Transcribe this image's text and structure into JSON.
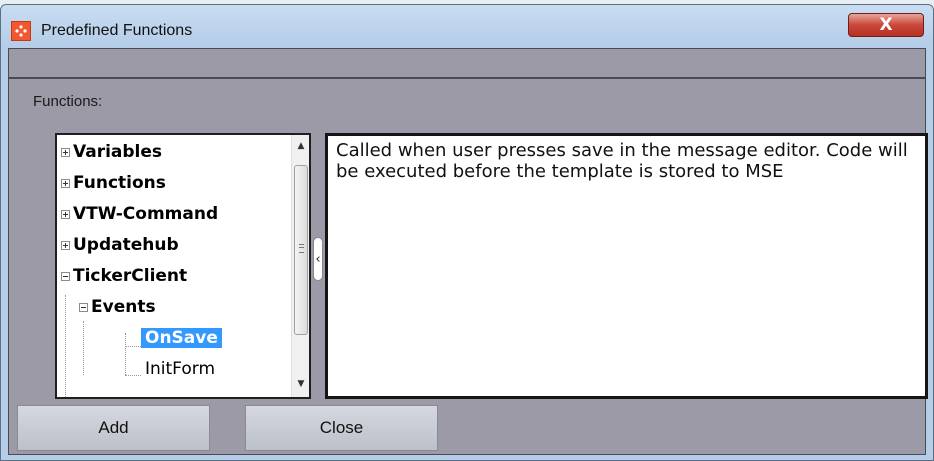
{
  "window": {
    "title": "Predefined Functions",
    "close_glyph": "X"
  },
  "group": {
    "label": "Functions:"
  },
  "tree": {
    "items": [
      {
        "label": "Variables",
        "expander": "plus"
      },
      {
        "label": "Functions",
        "expander": "plus"
      },
      {
        "label": "VTW-Command",
        "expander": "plus"
      },
      {
        "label": "Updatehub",
        "expander": "plus"
      },
      {
        "label": "TickerClient",
        "expander": "minus"
      },
      {
        "label": "Events",
        "expander": "minus"
      },
      {
        "label": "OnSave",
        "selected": true
      },
      {
        "label": "InitForm"
      }
    ]
  },
  "description": "Called when user presses save in the message editor. Code will be executed before the template is stored to MSE",
  "buttons": {
    "add": "Add",
    "close": "Close"
  },
  "colors": {
    "selection": "#3399ff",
    "panel": "#9c9aa6",
    "close_button": "#c9483a"
  }
}
